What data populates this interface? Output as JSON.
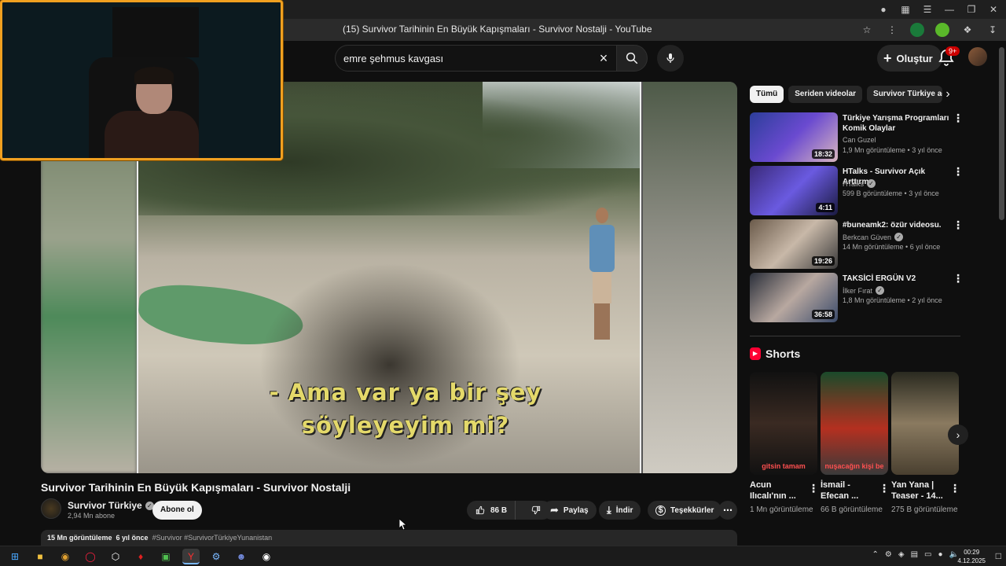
{
  "browser": {
    "tab_title": "(15) Survivor Tarihinin En Büyük Kapışmaları - Survivor Nostalji - YouTube"
  },
  "header": {
    "search_value": "emre şehmus kavgası",
    "create_label": "Oluştur",
    "notification_count": "9+"
  },
  "video": {
    "subtitle_line1": "- Ama var ya bir şey",
    "subtitle_line2": "söyleyeyim mi?",
    "title": "Survivor Tarihinin En Büyük Kapışmaları - Survivor Nostalji",
    "channel": "Survivor Türkiye",
    "subscribers": "2,94 Mn abone",
    "subscribe_label": "Abone ol",
    "likes": "86 B",
    "share_label": "Paylaş",
    "download_label": "İndir",
    "thanks_label": "Teşekkürler",
    "views": "15 Mn görüntüleme",
    "age": "6 yıl önce",
    "tags": "#Survivor #SurvivorTürkiyeYunanistan"
  },
  "sidebar": {
    "chips": [
      "Tümü",
      "Seriden videolar",
      "Survivor Türkiye adlı y"
    ],
    "recommendations": [
      {
        "title": "Türkiye Yarışma Programları Komik Olaylar",
        "channel": "Can Guzel",
        "meta": "1,9 Mn görüntüleme • 3 yıl önce",
        "duration": "18:32",
        "verified": false
      },
      {
        "title": "HTalks - Survivor Açık Arttırma",
        "channel": "HTalks",
        "meta": "599 B görüntüleme • 3 yıl önce",
        "duration": "4:11",
        "verified": true
      },
      {
        "title": "#buneamk2: özür videosu.",
        "channel": "Berkcan Güven",
        "meta": "14 Mn görüntüleme • 6 yıl önce",
        "duration": "19:26",
        "verified": true
      },
      {
        "title": "TAKSİCİ ERGÜN V2",
        "channel": "İlker Fırat",
        "meta": "1,8 Mn görüntüleme • 2 yıl önce",
        "duration": "36:58",
        "verified": true
      }
    ],
    "shorts_heading": "Shorts",
    "shorts": [
      {
        "title": "Acun Ilıcalı'nın ...",
        "views": "1 Mn görüntüleme",
        "caption": "gitsin tamam"
      },
      {
        "title": "İsmail - Efecan ...",
        "views": "66 B görüntüleme",
        "caption": "nuşacağın kişi be"
      },
      {
        "title": "Yan Yana | Teaser - 14...",
        "views": "275 B görüntüleme",
        "caption": ""
      }
    ]
  },
  "taskbar": {
    "time": "00:29",
    "date": "4.12.2025"
  },
  "colors": {
    "accent_red": "#ff0033",
    "webcam_border": "#f0a020",
    "background": "#0f0f0f"
  }
}
